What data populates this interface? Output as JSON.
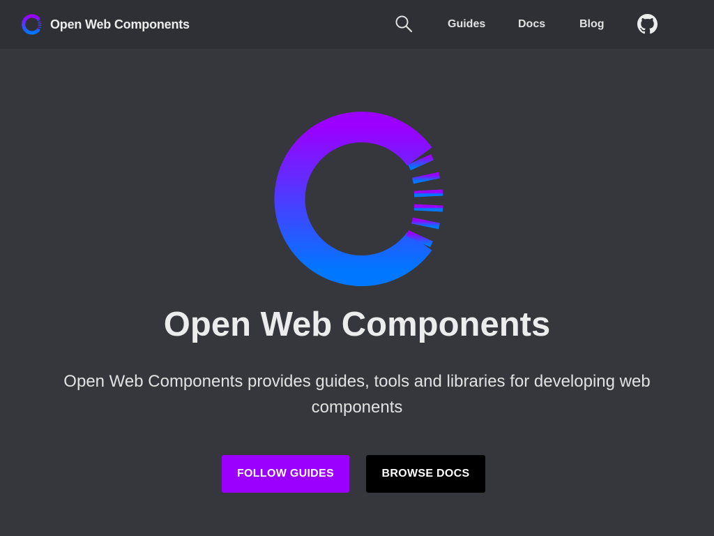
{
  "header": {
    "brand_name": "Open Web Components",
    "brand_logo_icon": "open-web-components-logo",
    "search_icon": "search-icon",
    "nav": [
      {
        "label": "Guides"
      },
      {
        "label": "Docs"
      },
      {
        "label": "Blog"
      }
    ],
    "github_icon": "github-icon"
  },
  "hero": {
    "logo_icon": "open-web-components-logo",
    "title": "Open Web Components",
    "description": "Open Web Components provides guides, tools and libraries for developing web components",
    "buttons": {
      "primary_label": "FOLLOW GUIDES",
      "secondary_label": "BROWSE DOCS"
    }
  },
  "colors": {
    "background": "#36373d",
    "header_background": "#2f3035",
    "accent_purple": "#9b00ff",
    "accent_blue": "#0077ff",
    "text": "#ececec"
  }
}
